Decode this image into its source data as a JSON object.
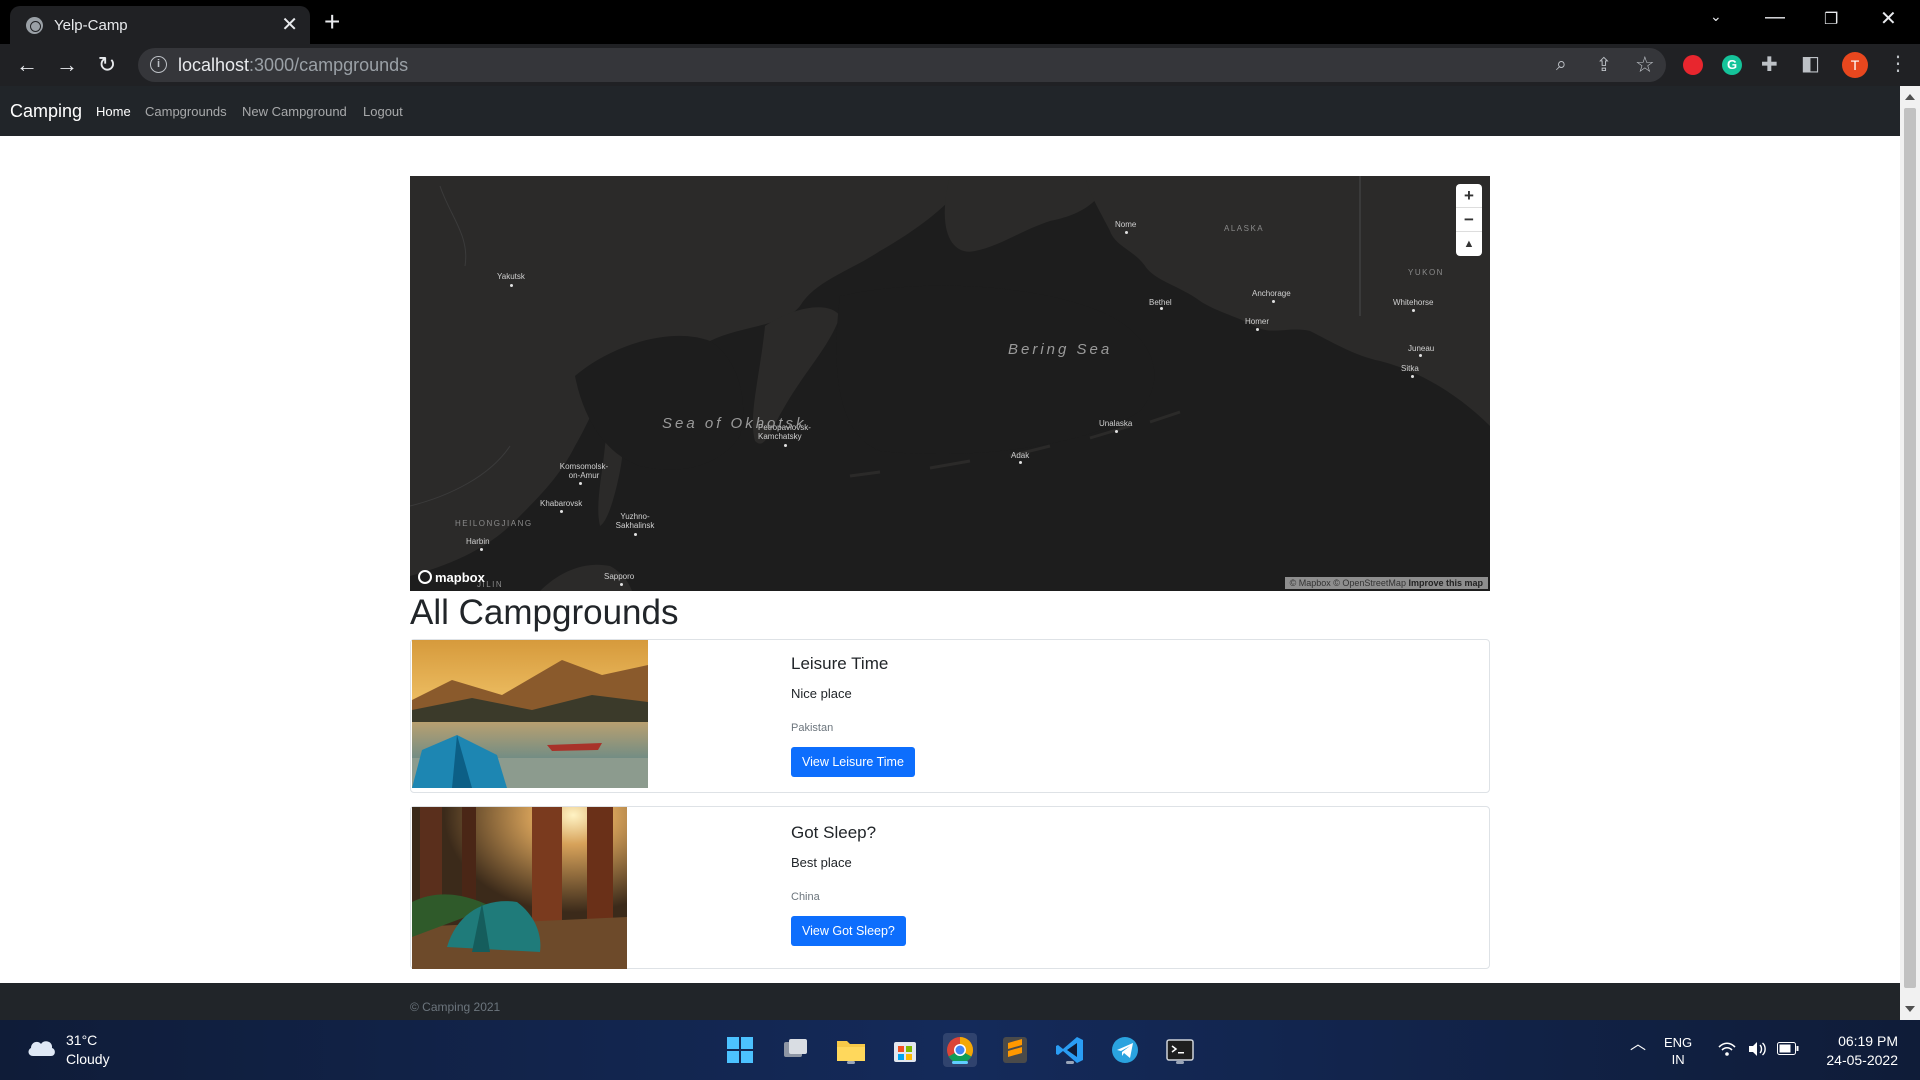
{
  "browser": {
    "tab_title": "Yelp-Camp",
    "url_host": "localhost",
    "url_path": ":3000/campgrounds",
    "profile_initial": "T"
  },
  "navbar": {
    "brand": "Camping",
    "links": [
      "Home",
      "Campgrounds",
      "New Campground",
      "Logout"
    ]
  },
  "map": {
    "places": [
      "Yakutsk",
      "Nome",
      "ALASKA",
      "YUKON",
      "Bethel",
      "Anchorage",
      "Whitehorse",
      "Homer",
      "Juneau",
      "Sitka",
      "Petropavlovsk-Kamchatsky",
      "Unalaska",
      "Adak",
      "Komsomolsk-on-Amur",
      "Khabarovsk",
      "HEILONGJIANG",
      "Yuzhno-Sakhalinsk",
      "Harbin",
      "Sapporo",
      "JILIN"
    ],
    "sea_labels": [
      "Bering Sea",
      "Sea of Okhotsk"
    ],
    "logo": "mapbox",
    "attribution": "© Mapbox © OpenStreetMap",
    "attribution_link": "Improve this map"
  },
  "heading": "All Campgrounds",
  "campgrounds": [
    {
      "title": "Leisure Time",
      "description": "Nice place",
      "location": "Pakistan",
      "button": "View Leisure Time"
    },
    {
      "title": "Got Sleep?",
      "description": "Best place",
      "location": "China",
      "button": "View Got Sleep?"
    }
  ],
  "footer": {
    "copyright": "© Camping 2021"
  },
  "taskbar": {
    "weather_temp": "31°C",
    "weather_desc": "Cloudy",
    "lang_1": "ENG",
    "lang_2": "IN",
    "time": "06:19 PM",
    "date": "24-05-2022"
  },
  "colors": {
    "primary": "#0d6efd",
    "navbar": "#212529",
    "map_water": "#1d1d1d",
    "map_land": "#2b2a29"
  }
}
